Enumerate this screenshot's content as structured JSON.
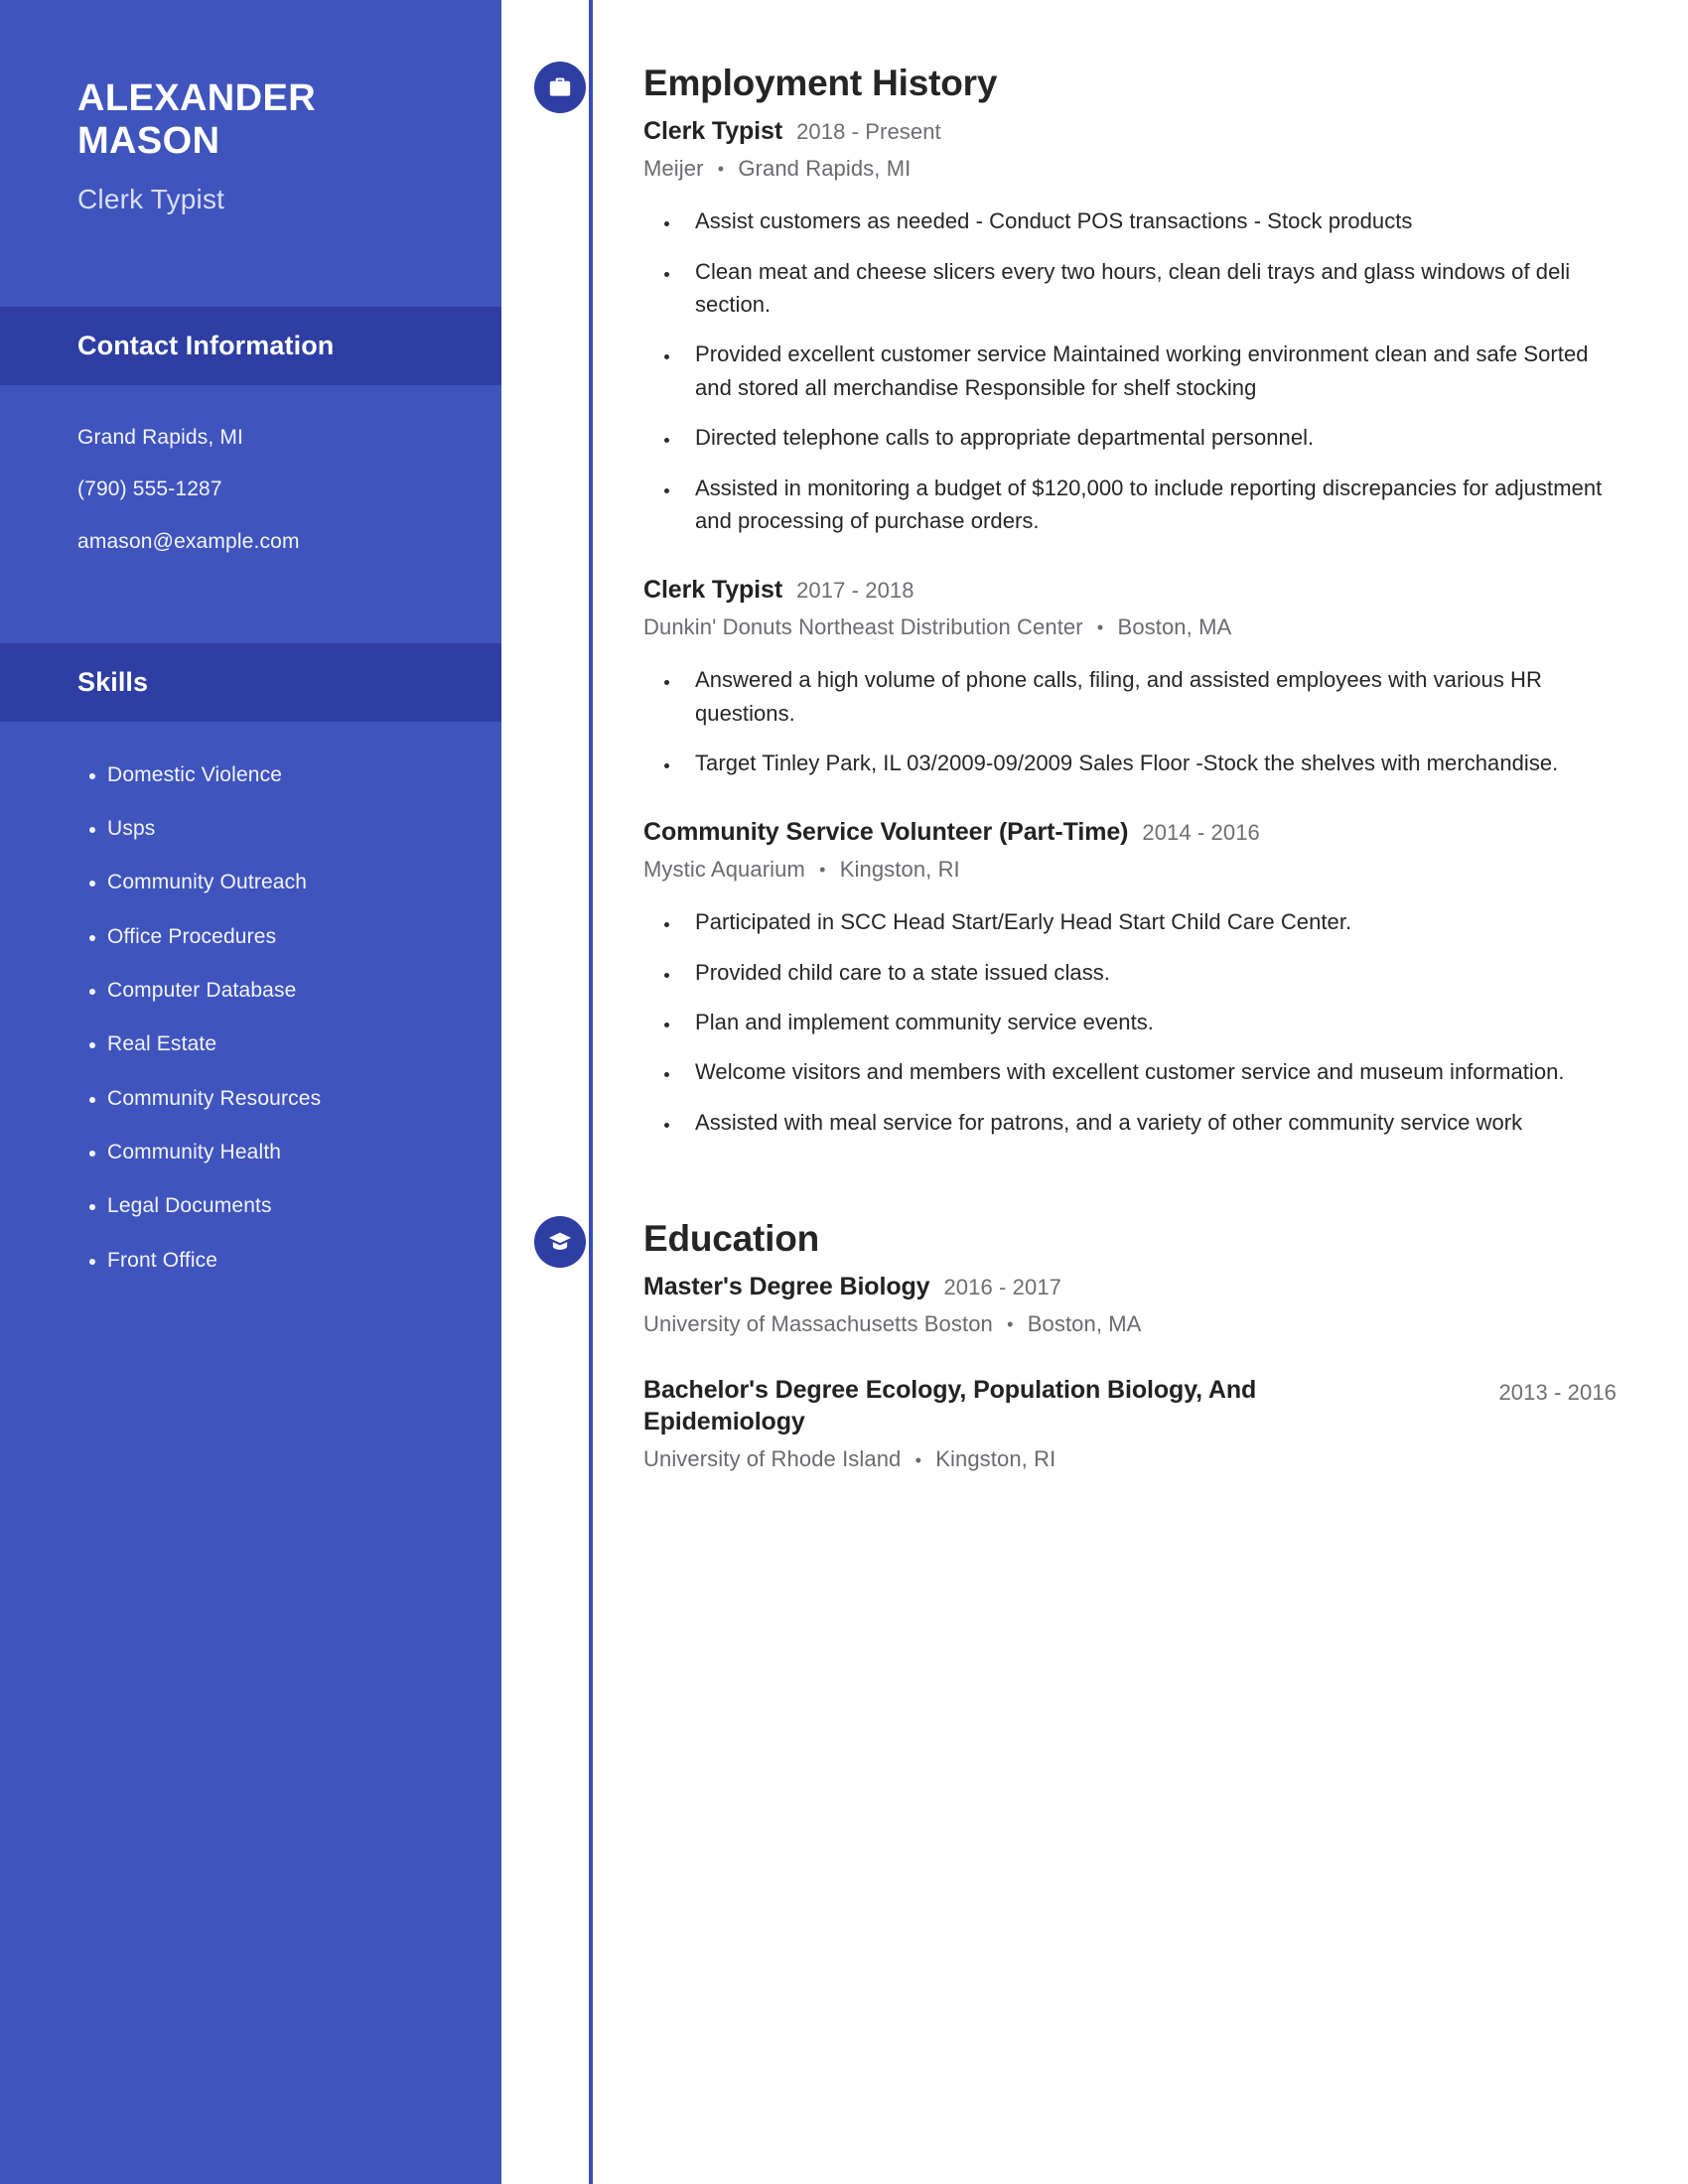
{
  "sidebar": {
    "name": "Alexander Mason",
    "role": "Clerk Typist",
    "contact_header": "Contact Information",
    "contact": [
      "Grand Rapids, MI",
      "(790) 555-1287",
      "amason@example.com"
    ],
    "skills_header": "Skills",
    "skills": [
      "Domestic Violence",
      "Usps",
      "Community Outreach",
      "Office Procedures",
      "Computer Database",
      "Real Estate",
      "Community Resources",
      "Community Health",
      "Legal Documents",
      "Front Office"
    ]
  },
  "employment": {
    "title": "Employment History",
    "icon": "briefcase-icon",
    "entries": [
      {
        "title": "Clerk Typist",
        "date": "2018 - Present",
        "company": "Meijer",
        "location": "Grand Rapids, MI",
        "bullets": [
          "Assist customers as needed - Conduct POS transactions - Stock products",
          "Clean meat and cheese slicers every two hours, clean deli trays and glass windows of deli section.",
          "Provided excellent customer service Maintained working environment clean and safe Sorted and stored all merchandise Responsible for shelf stocking",
          "Directed telephone calls to appropriate departmental personnel.",
          "Assisted in monitoring a budget of $120,000 to include reporting discrepancies for adjustment and processing of purchase orders."
        ]
      },
      {
        "title": "Clerk Typist",
        "date": "2017 - 2018",
        "company": "Dunkin' Donuts Northeast Distribution Center",
        "location": "Boston, MA",
        "bullets": [
          "Answered a high volume of phone calls, filing, and assisted employees with various HR questions.",
          "Target Tinley Park, IL 03/2009-09/2009 Sales Floor -Stock the shelves with merchandise."
        ]
      },
      {
        "title": "Community Service Volunteer (Part-Time)",
        "date": "2014 - 2016",
        "company": "Mystic Aquarium",
        "location": "Kingston, RI",
        "bullets": [
          "Participated in SCC Head Start/Early Head Start Child Care Center.",
          "Provided child care to a state issued class.",
          "Plan and implement community service events.",
          "Welcome visitors and members with excellent customer service and museum information.",
          "Assisted with meal service for patrons, and a variety of other community service work"
        ]
      }
    ]
  },
  "education": {
    "title": "Education",
    "icon": "graduation-cap-icon",
    "entries": [
      {
        "title": "Master's Degree Biology",
        "date": "2016 - 2017",
        "school": "University of Massachusetts Boston",
        "location": "Boston, MA",
        "date_right": false
      },
      {
        "title": "Bachelor's Degree Ecology, Population Biology, And Epidemiology",
        "date": "2013 - 2016",
        "school": "University of Rhode Island",
        "location": "Kingston, RI",
        "date_right": true
      }
    ]
  },
  "theme": {
    "sidebar_bg": "#4054bd",
    "sidebar_header_bg": "#2e3ea2",
    "accent": "#2e3ea2",
    "timeline": "#3a4cb5"
  },
  "separator": "•"
}
